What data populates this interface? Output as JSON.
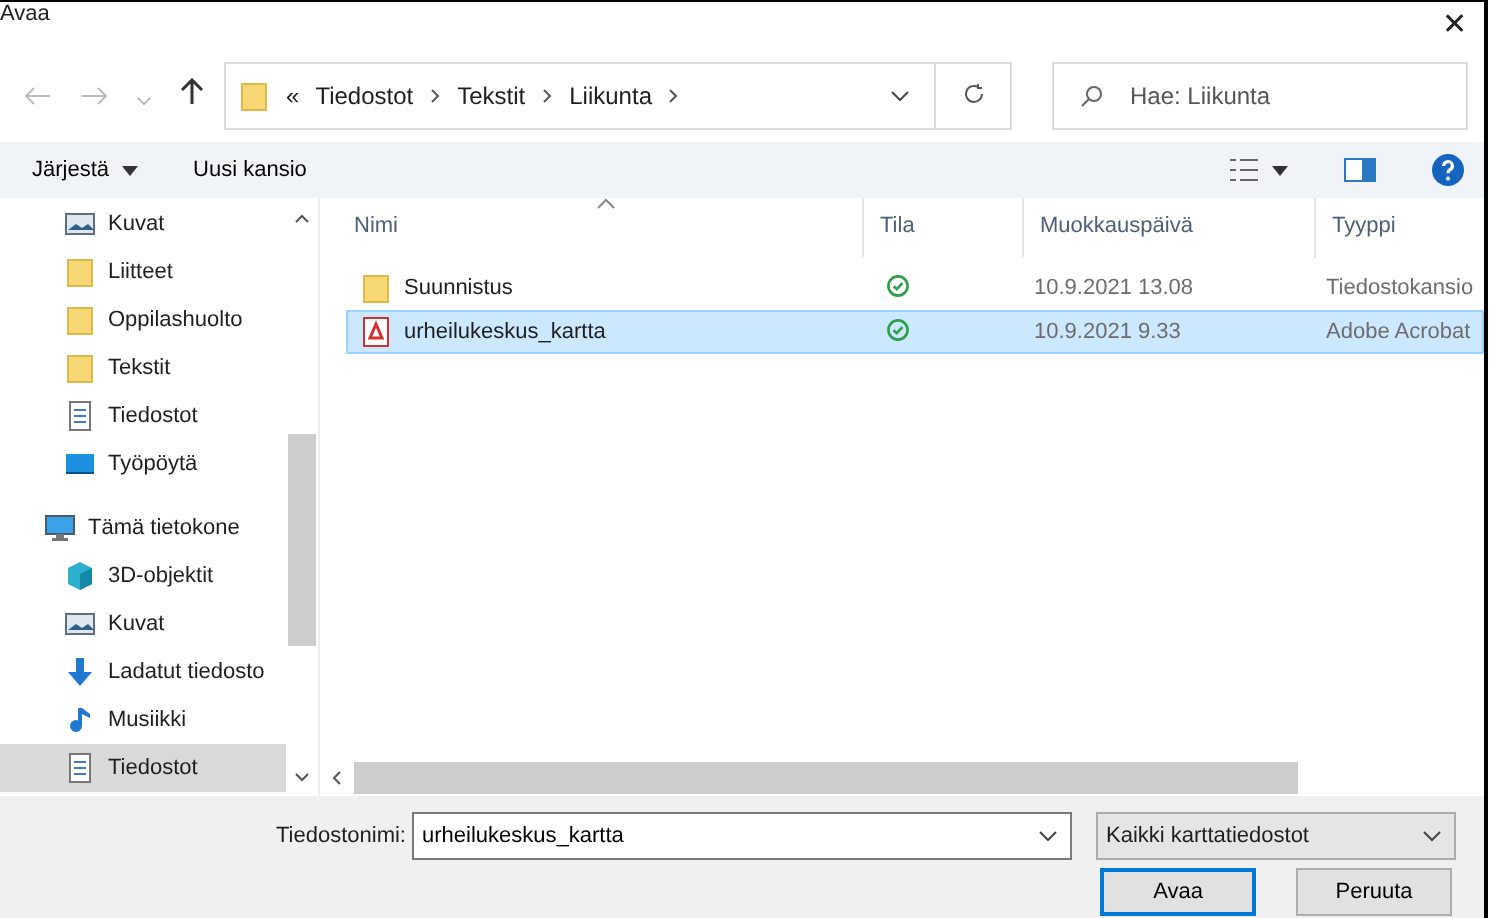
{
  "window": {
    "title": "Avaa",
    "close": "✕"
  },
  "nav": {
    "breadcrumb_prefix": "«",
    "path": [
      "Tiedostot",
      "Tekstit",
      "Liikunta"
    ],
    "search": {
      "placeholder": "Hae: Liikunta"
    }
  },
  "toolbar": {
    "organize": "Järjestä",
    "new_folder": "Uusi kansio"
  },
  "sidebar": {
    "items": [
      {
        "label": "Kuvat",
        "kind": "pictures",
        "selected": false
      },
      {
        "label": "Liitteet",
        "kind": "folder",
        "selected": false
      },
      {
        "label": "Oppilashuolto",
        "kind": "folder",
        "selected": false
      },
      {
        "label": "Tekstit",
        "kind": "folder",
        "selected": false
      },
      {
        "label": "Tiedostot",
        "kind": "document",
        "selected": false
      },
      {
        "label": "Työpöytä",
        "kind": "desktop",
        "selected": false
      },
      {
        "label": "Tämä tietokone",
        "kind": "computer",
        "selected": false,
        "children": [
          {
            "label": "3D-objektit",
            "kind": "cube",
            "selected": false
          },
          {
            "label": "Kuvat",
            "kind": "pictures",
            "selected": false
          },
          {
            "label": "Ladatut tiedosto",
            "kind": "download",
            "selected": false
          },
          {
            "label": "Musiikki",
            "kind": "music",
            "selected": false
          },
          {
            "label": "Tiedostot",
            "kind": "document",
            "selected": true
          }
        ]
      }
    ]
  },
  "table": {
    "columns": [
      "Nimi",
      "Tila",
      "Muokkauspäivä",
      "Tyyppi"
    ],
    "rows": [
      {
        "name": "Suunnistus",
        "kind": "folder",
        "synced": true,
        "date": "10.9.2021 13.08",
        "type": "Tiedostokansio",
        "selected": false
      },
      {
        "name": "urheilukeskus_kartta",
        "kind": "pdf",
        "synced": true,
        "date": "10.9.2021 9.33",
        "type": "Adobe Acrobat",
        "selected": true
      }
    ]
  },
  "footer": {
    "filename_label": "Tiedostonimi:",
    "filename": "urheilukeskus_kartta",
    "filter": "Kaikki karttatiedostot",
    "buttons": [
      {
        "label": "Avaa",
        "default": true
      },
      {
        "label": "Peruuta",
        "default": false
      }
    ]
  }
}
